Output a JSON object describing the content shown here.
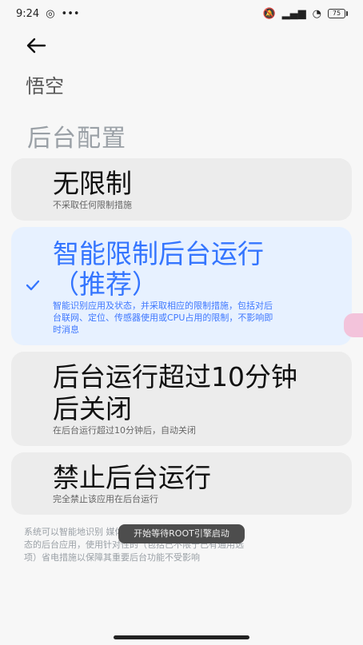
{
  "status_bar": {
    "time": "9:24",
    "left_icons": [
      "notification-icon",
      "more-dots-icon"
    ],
    "right_icons": [
      "muted-bell-icon",
      "signal-icon",
      "wifi-icon"
    ],
    "battery": "75"
  },
  "header": {
    "back_icon": "back-arrow-icon",
    "app_name": "悟空"
  },
  "section": {
    "title": "后台配置"
  },
  "options": [
    {
      "title": "无限制",
      "subtitle": "不采取任何限制措施",
      "selected": false
    },
    {
      "title_line1": "智能限制后台运行",
      "title_line2": "（推荐）",
      "subtitle_line1": "智能识别应用及状态，并采取相应的限制措施，包括对后",
      "subtitle_line2": "台联网、定位、传感器使用或CPU占用的限制，不影响即",
      "subtitle_line3": "时消息",
      "selected": true
    },
    {
      "title_line1": "后台运行超过10分钟",
      "title_line2": "后关闭",
      "subtitle": "在后台运行超过10分钟后，自动关闭",
      "selected": false
    },
    {
      "title": "禁止后台运行",
      "subtitle": "完全禁止该应用在后台运行",
      "selected": false
    }
  ],
  "footnote": {
    "line1": "系统可以智能地识别                      媒体播放等状",
    "line2": "态的后台应用，使用针对性的（包括已不限于已有通用选",
    "line3": "项）省电措施以保障其重要后台功能不受影响"
  },
  "toast": {
    "text": "开始等待ROOT引擎启动"
  },
  "colors": {
    "accent": "#3475ff",
    "selected_card": "#e7f1ff",
    "card": "#ececec",
    "background": "#f7f7f7"
  }
}
